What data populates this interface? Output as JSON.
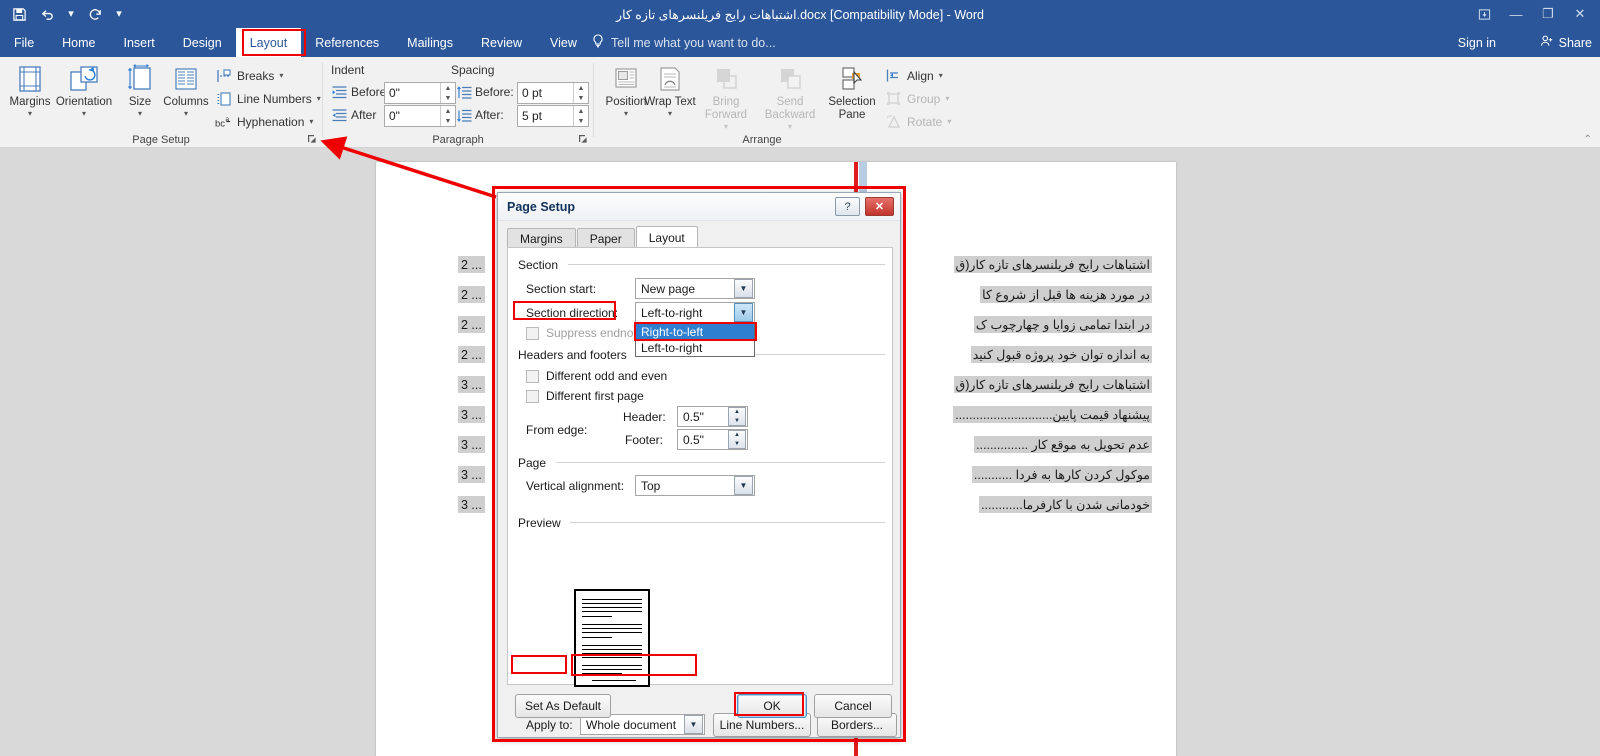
{
  "window": {
    "title": "اشتباهات رایج فریلنسرهای تازه کار.docx [Compatibility Mode] - Word",
    "quick_access": {
      "save": "save-icon",
      "undo": "undo-icon",
      "redo": "redo-icon",
      "customize": "customize-icon"
    },
    "controls": {
      "ribbon_display": "⯐",
      "minimize": "—",
      "restore": "❐",
      "close": "✕"
    }
  },
  "ribbon_tabs": [
    {
      "label": "File",
      "active": false
    },
    {
      "label": "Home",
      "active": false
    },
    {
      "label": "Insert",
      "active": false
    },
    {
      "label": "Design",
      "active": false
    },
    {
      "label": "Layout",
      "active": true
    },
    {
      "label": "References",
      "active": false
    },
    {
      "label": "Mailings",
      "active": false
    },
    {
      "label": "Review",
      "active": false
    },
    {
      "label": "View",
      "active": false
    }
  ],
  "tellme": {
    "placeholder": "Tell me what you want to do...",
    "icon": "lightbulb-icon"
  },
  "account": {
    "sign_in": "Sign in",
    "share": "Share"
  },
  "ribbon": {
    "page_setup": {
      "group_label": "Page Setup",
      "buttons": [
        {
          "label": "Margins",
          "icon": "margins-icon"
        },
        {
          "label": "Orientation",
          "icon": "orientation-icon"
        },
        {
          "label": "Size",
          "icon": "size-icon"
        },
        {
          "label": "Columns",
          "icon": "columns-icon"
        }
      ],
      "small_buttons": [
        {
          "label": "Breaks",
          "icon": "breaks-icon"
        },
        {
          "label": "Line Numbers",
          "icon": "line-numbers-icon"
        },
        {
          "label": "Hyphenation",
          "icon": "hyphenation-icon"
        }
      ]
    },
    "paragraph": {
      "group_label": "Paragraph",
      "indent_title": "Indent",
      "spacing_title": "Spacing",
      "indent_before_label": "Before",
      "indent_before_value": "0\"",
      "indent_after_label": "After",
      "indent_after_value": "0\"",
      "spacing_before_label": "Before:",
      "spacing_before_value": "0 pt",
      "spacing_after_label": "After:",
      "spacing_after_value": "5 pt"
    },
    "arrange": {
      "group_label": "Arrange",
      "buttons": [
        {
          "label": "Position",
          "icon": "position-icon",
          "disabled": false
        },
        {
          "label": "Wrap Text",
          "icon": "wrap-text-icon",
          "disabled": false
        },
        {
          "label": "Bring Forward",
          "icon": "bring-forward-icon",
          "disabled": true
        },
        {
          "label": "Send Backward",
          "icon": "send-backward-icon",
          "disabled": true
        },
        {
          "label": "Selection Pane",
          "icon": "selection-pane-icon",
          "disabled": false
        }
      ],
      "small_buttons": [
        {
          "label": "Align",
          "icon": "align-icon",
          "disabled": false
        },
        {
          "label": "Group",
          "icon": "group-icon",
          "disabled": true
        },
        {
          "label": "Rotate",
          "icon": "rotate-icon",
          "disabled": true
        }
      ]
    }
  },
  "document": {
    "lines": [
      {
        "page": "2 ...",
        "text": "اشتباهات رایج فریلنسرهای تازه کار(ق"
      },
      {
        "page": "2 ...",
        "text": "در مورد هزینه ها قبل از شروع کا"
      },
      {
        "page": "2 ...",
        "text": "در ابتدا تمامی زوایا و چهارچوب ک"
      },
      {
        "page": "2 ...",
        "text": "به اندازه توان خود پروژه قبول کنید"
      },
      {
        "page": "3 ...",
        "text": "اشتباهات رایج فریلنسرهای تازه کار(ق"
      },
      {
        "page": "3 ...",
        "text": "پیشنهاد قیمت پایین............................"
      },
      {
        "page": "3 ...",
        "text": "عدم تحویل به موقع کار ..............."
      },
      {
        "page": "3 ...",
        "text": "موکول کردن کارها به فردا ..........."
      },
      {
        "page": "3 ...",
        "text": "خودمانی شدن با کارفرما............"
      }
    ]
  },
  "dialog": {
    "title": "Page Setup",
    "help_label": "?",
    "close_label": "✕",
    "tabs": [
      {
        "label": "Margins",
        "active": false
      },
      {
        "label": "Paper",
        "active": false
      },
      {
        "label": "Layout",
        "active": true
      }
    ],
    "section": {
      "title": "Section",
      "section_start_label": "Section start:",
      "section_start_value": "New page",
      "section_direction_label": "Section direction:",
      "section_direction_value": "Left-to-right",
      "section_direction_options": [
        "Right-to-left",
        "Left-to-right"
      ],
      "section_direction_selected": "Right-to-left",
      "suppress_endnotes_label": "Suppress endnotes"
    },
    "headers_footers": {
      "title": "Headers and footers",
      "different_odd_even": "Different odd and even",
      "different_first_page": "Different first page",
      "from_edge_label": "From edge:",
      "header_label": "Header:",
      "header_value": "0.5\"",
      "footer_label": "Footer:",
      "footer_value": "0.5\""
    },
    "page": {
      "title": "Page",
      "vertical_alignment_label": "Vertical alignment:",
      "vertical_alignment_value": "Top"
    },
    "preview": {
      "title": "Preview"
    },
    "apply": {
      "apply_to_label": "Apply to:",
      "apply_to_value": "Whole document",
      "line_numbers_button": "Line Numbers...",
      "borders_button": "Borders..."
    },
    "footer_buttons": {
      "set_as_default": "Set As Default",
      "ok": "OK",
      "cancel": "Cancel"
    }
  },
  "annotations": {
    "highlight_color": "#ee0000",
    "arrow": "red-arrow-to-page-setup-launcher"
  }
}
